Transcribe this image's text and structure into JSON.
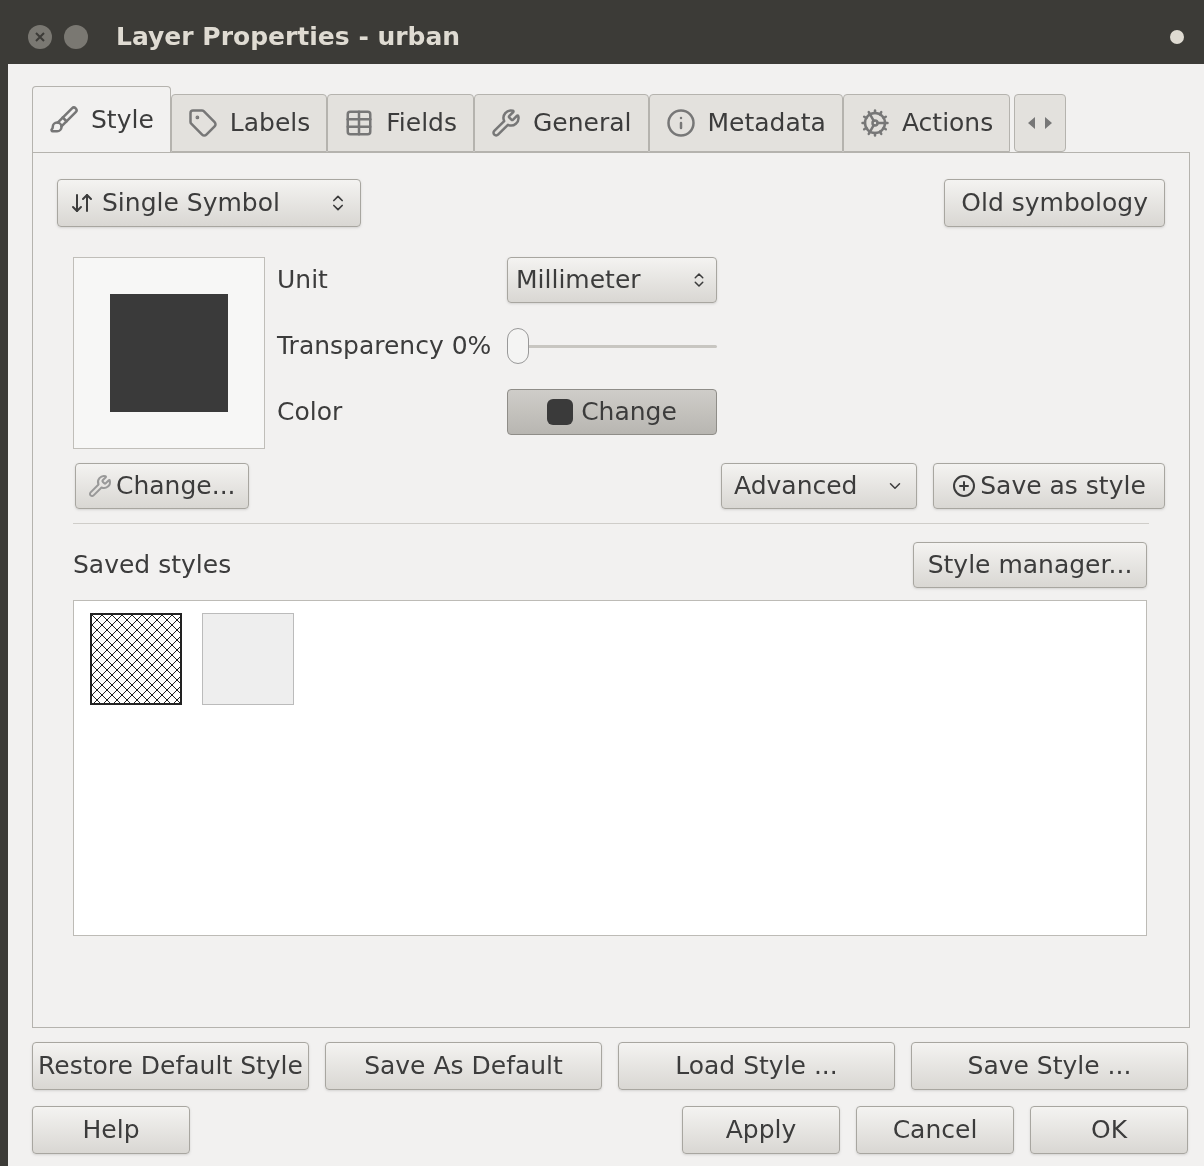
{
  "window": {
    "title": "Layer Properties - urban"
  },
  "tabs": [
    {
      "label": "Style",
      "selected": true
    },
    {
      "label": "Labels",
      "selected": false
    },
    {
      "label": "Fields",
      "selected": false
    },
    {
      "label": "General",
      "selected": false
    },
    {
      "label": "Metadata",
      "selected": false
    },
    {
      "label": "Actions",
      "selected": false
    }
  ],
  "renderer": {
    "value": "Single Symbol"
  },
  "old_symbology_button": "Old symbology",
  "symbol": {
    "unit_label": "Unit",
    "unit_value": "Millimeter",
    "transparency_label": "Transparency 0%",
    "transparency": {
      "level": 0
    },
    "color_label": "Color",
    "color_button": "Change",
    "color": "#3a3a3a"
  },
  "change_button": "Change...",
  "advanced_button": "Advanced",
  "save_as_style_button": "Save as style",
  "saved_styles": {
    "label": "Saved styles",
    "manager_button": "Style manager...",
    "items": [
      {
        "kind": "crosshatch",
        "selected": true
      },
      {
        "kind": "plain",
        "selected": false
      }
    ]
  },
  "bottom_buttons": [
    "Restore Default Style",
    "Save As Default",
    "Load Style ...",
    "Save Style ..."
  ],
  "help_button": "Help",
  "dialog_buttons": [
    "Apply",
    "Cancel",
    "OK"
  ]
}
